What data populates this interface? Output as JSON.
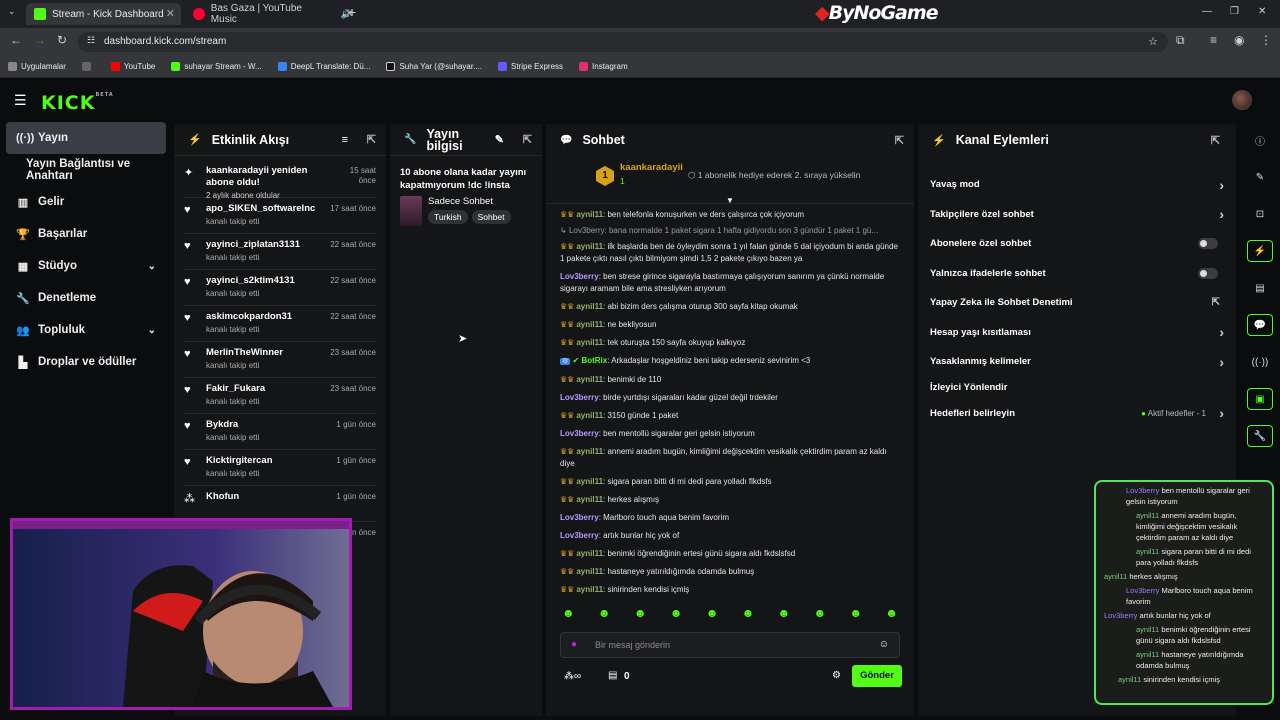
{
  "browser": {
    "tabs": [
      {
        "title": "Stream - Kick Dashboard"
      },
      {
        "title": "Bas Gaza | YouTube Music"
      }
    ],
    "url": "dashboard.kick.com/stream",
    "watermark": "ByNoGame",
    "bookmarks": [
      "Uygulamalar",
      "YouTube",
      "suhayar Stream - W...",
      "DeepL Translate: Dü...",
      "Suha Yar (@suhayar....",
      "Stripe Express",
      "Instagram"
    ]
  },
  "brand": {
    "logo": "KICK",
    "beta": "BETA",
    "accent": "#53fc18"
  },
  "sidebar": {
    "items": [
      {
        "label": "Yayın",
        "icon": "broadcast-icon",
        "active": true
      },
      {
        "label": "Yayın Bağlantısı ve Anahtarı",
        "icon": "",
        "active": false
      },
      {
        "label": "Gelir",
        "icon": "chart-icon"
      },
      {
        "label": "Başarılar",
        "icon": "trophy-icon"
      },
      {
        "label": "Stüdyo",
        "icon": "studio-icon",
        "chevron": true
      },
      {
        "label": "Denetleme",
        "icon": "wrench-icon"
      },
      {
        "label": "Topluluk",
        "icon": "community-icon",
        "chevron": true
      },
      {
        "label": "Droplar ve ödüller",
        "icon": "drops-icon"
      }
    ]
  },
  "activity": {
    "title": "Etkinlik Akışı",
    "items": [
      {
        "name": "kaankaradayii yeniden abone oldu!",
        "sub": "2 aylık abone oldular",
        "time": "15 saat önce",
        "icon": "sparkle-icon"
      },
      {
        "name": "apo_SIKEN_softwareInc",
        "sub": "kanalı takip etti",
        "time": "17 saat önce",
        "icon": "heart-icon"
      },
      {
        "name": "yayinci_ziplatan3131",
        "sub": "kanalı takip etti",
        "time": "22 saat önce",
        "icon": "heart-icon"
      },
      {
        "name": "yayinci_s2ktim4131",
        "sub": "kanalı takip etti",
        "time": "22 saat önce",
        "icon": "heart-icon"
      },
      {
        "name": "askimcokpardon31",
        "sub": "kanalı takip etti",
        "time": "22 saat önce",
        "icon": "heart-icon"
      },
      {
        "name": "MerlinTheWinner",
        "sub": "kanalı takip etti",
        "time": "23 saat önce",
        "icon": "heart-icon"
      },
      {
        "name": "Fakir_Fukara",
        "sub": "kanalı takip etti",
        "time": "23 saat önce",
        "icon": "heart-icon"
      },
      {
        "name": "Bykdra",
        "sub": "kanalı takip etti",
        "time": "1 gün önce",
        "icon": "heart-icon"
      },
      {
        "name": "Kicktirgitercan",
        "sub": "kanalı takip etti",
        "time": "1 gün önce",
        "icon": "heart-icon"
      },
      {
        "name": "Khofun",
        "sub": "",
        "time": "1 gün önce",
        "icon": "people-icon"
      }
    ],
    "extra_time": "1 gün önce"
  },
  "streaminfo": {
    "title": "Yayın bilgisi",
    "stream_title": "10 abone olana kadar yayını kapatmıyorum !dc !insta",
    "category": "Sadece Sohbet",
    "tags": [
      "Turkish",
      "Sohbet"
    ]
  },
  "chat": {
    "title": "Sohbet",
    "pinned": {
      "rank": "1",
      "user": "kaankaradayii",
      "count": "1",
      "text": "1 abonelik hediye ederek 2. sıraya yükselin"
    },
    "messages": [
      {
        "user": "aynil11",
        "text": "ben telefonla konuşurken ve ders çalışırca çok içiyorum",
        "c": "g"
      },
      {
        "user": "Lov3berry",
        "text": "bana normalde 1 paket sigara 1 hafta gidiyordu son 3 gündür 1 paket 1 gü...",
        "c": "r"
      },
      {
        "user": "aynil11",
        "text": "ilk başlarda ben de öyleydim sonra 1 yıl falan günde 5 dal içiyodum bi anda günde 1 pakete çıktı nasıl çıktı bilmiyom şimdi 1,5 2 pakete çıkıyo bazen ya",
        "c": "g"
      },
      {
        "user": "Lov3berry",
        "text": "ben strese girince sigarayla bastırmaya çalışıyorum sanırım ya çünkü normalde sigarayı aramam bile ama stresliyken arıyorum",
        "c": "p"
      },
      {
        "user": "aynil11",
        "text": "abi bizim ders çalışma oturup 300 sayfa kitap okumak",
        "c": "g"
      },
      {
        "user": "aynil11",
        "text": "ne bekliyosun",
        "c": "g"
      },
      {
        "user": "aynil11",
        "text": "tek oturuşta 150 sayfa okuyup kalkıyoz",
        "c": "g"
      },
      {
        "user": "BotRix",
        "text": "Arkadaşlar hoşgeldiniz beni takip ederseniz sevinirim <3",
        "c": "b"
      },
      {
        "user": "aynil11",
        "text": "benimki de 110",
        "c": "g"
      },
      {
        "user": "Lov3berry",
        "text": "birde yurtdışı sigaraları kadar güzel değil trdekiler",
        "c": "p"
      },
      {
        "user": "aynil11",
        "text": "3150 günde 1 paket",
        "c": "g"
      },
      {
        "user": "Lov3berry",
        "text": "ben mentollü sigaralar geri gelsin istiyorum",
        "c": "p"
      },
      {
        "user": "aynil11",
        "text": "annemi aradım bugün, kimliğimi değişcektim vesikalık çektirdim param az kaldı diye",
        "c": "g"
      },
      {
        "user": "aynil11",
        "text": "sigara paran bitti di mi dedi para yolladı flkdsfs",
        "c": "g"
      },
      {
        "user": "aynil11",
        "text": "herkes alışmış",
        "c": "g"
      },
      {
        "user": "Lov3berry",
        "text": "Marlboro touch aqua benim favorim",
        "c": "p"
      },
      {
        "user": "Lov3berry",
        "text": "artık bunlar hiç yok of",
        "c": "p"
      },
      {
        "user": "aynil11",
        "text": "benimki öğrendiğinin ertesi günü sigara aldı fkdslsfsd",
        "c": "g"
      },
      {
        "user": "aynil11",
        "text": "hastaneye yatırıldığımda odamda bulmuş",
        "c": "g"
      },
      {
        "user": "aynil11",
        "text": "sinirinden kendisi içmiş",
        "c": "g"
      }
    ],
    "placeholder": "Bir mesaj gönderin",
    "count": "0",
    "send": "Gönder"
  },
  "actions": {
    "title": "Kanal Eylemleri",
    "items": [
      {
        "label": "Yavaş mod",
        "kind": "chev"
      },
      {
        "label": "Takipçilere özel sohbet",
        "kind": "chev"
      },
      {
        "label": "Abonelere özel sohbet",
        "kind": "toggle"
      },
      {
        "label": "Yalnızca ifadelerle sohbet",
        "kind": "toggle"
      },
      {
        "label": "Yapay Zeka ile Sohbet Denetimi",
        "kind": "ext"
      },
      {
        "label": "Hesap yaşı kısıtlaması",
        "kind": "chev"
      },
      {
        "label": "Yasaklanmış kelimeler",
        "kind": "chev"
      },
      {
        "label": "İzleyici Yönlendir",
        "kind": "none"
      },
      {
        "label": "Hedefleri belirleyin",
        "kind": "chev",
        "status": "Aktif hedefler - 1"
      }
    ]
  },
  "overlay": {
    "messages": [
      {
        "user": "Lov3berry",
        "text": "ben mentollü sigaralar geri gelsin istiyorum"
      },
      {
        "user": "aynil11",
        "text": "annemi aradım bugün, kimliğimi değişcektim vesikalık çektirdim param az kaldı diye"
      },
      {
        "user": "aynil11",
        "text": "sigara paran bitti di mi dedi para yolladı flkdsfs"
      },
      {
        "user": "aynil11",
        "text": "herkes alışmış"
      },
      {
        "user": "Lov3berry",
        "text": "Marlboro touch aqua benim favorim"
      },
      {
        "user": "Lov3berry",
        "text": "artık bunlar hiç yok of"
      },
      {
        "user": "aynil11",
        "text": "benimki öğrendiğinin ertesi günü sigara aldı fkdslsfsd"
      },
      {
        "user": "aynil11",
        "text": "hastaneye yatırıldığımda odamda bulmuş"
      },
      {
        "user": "aynil11",
        "text": "sinirinden kendisi içmiş"
      }
    ]
  }
}
